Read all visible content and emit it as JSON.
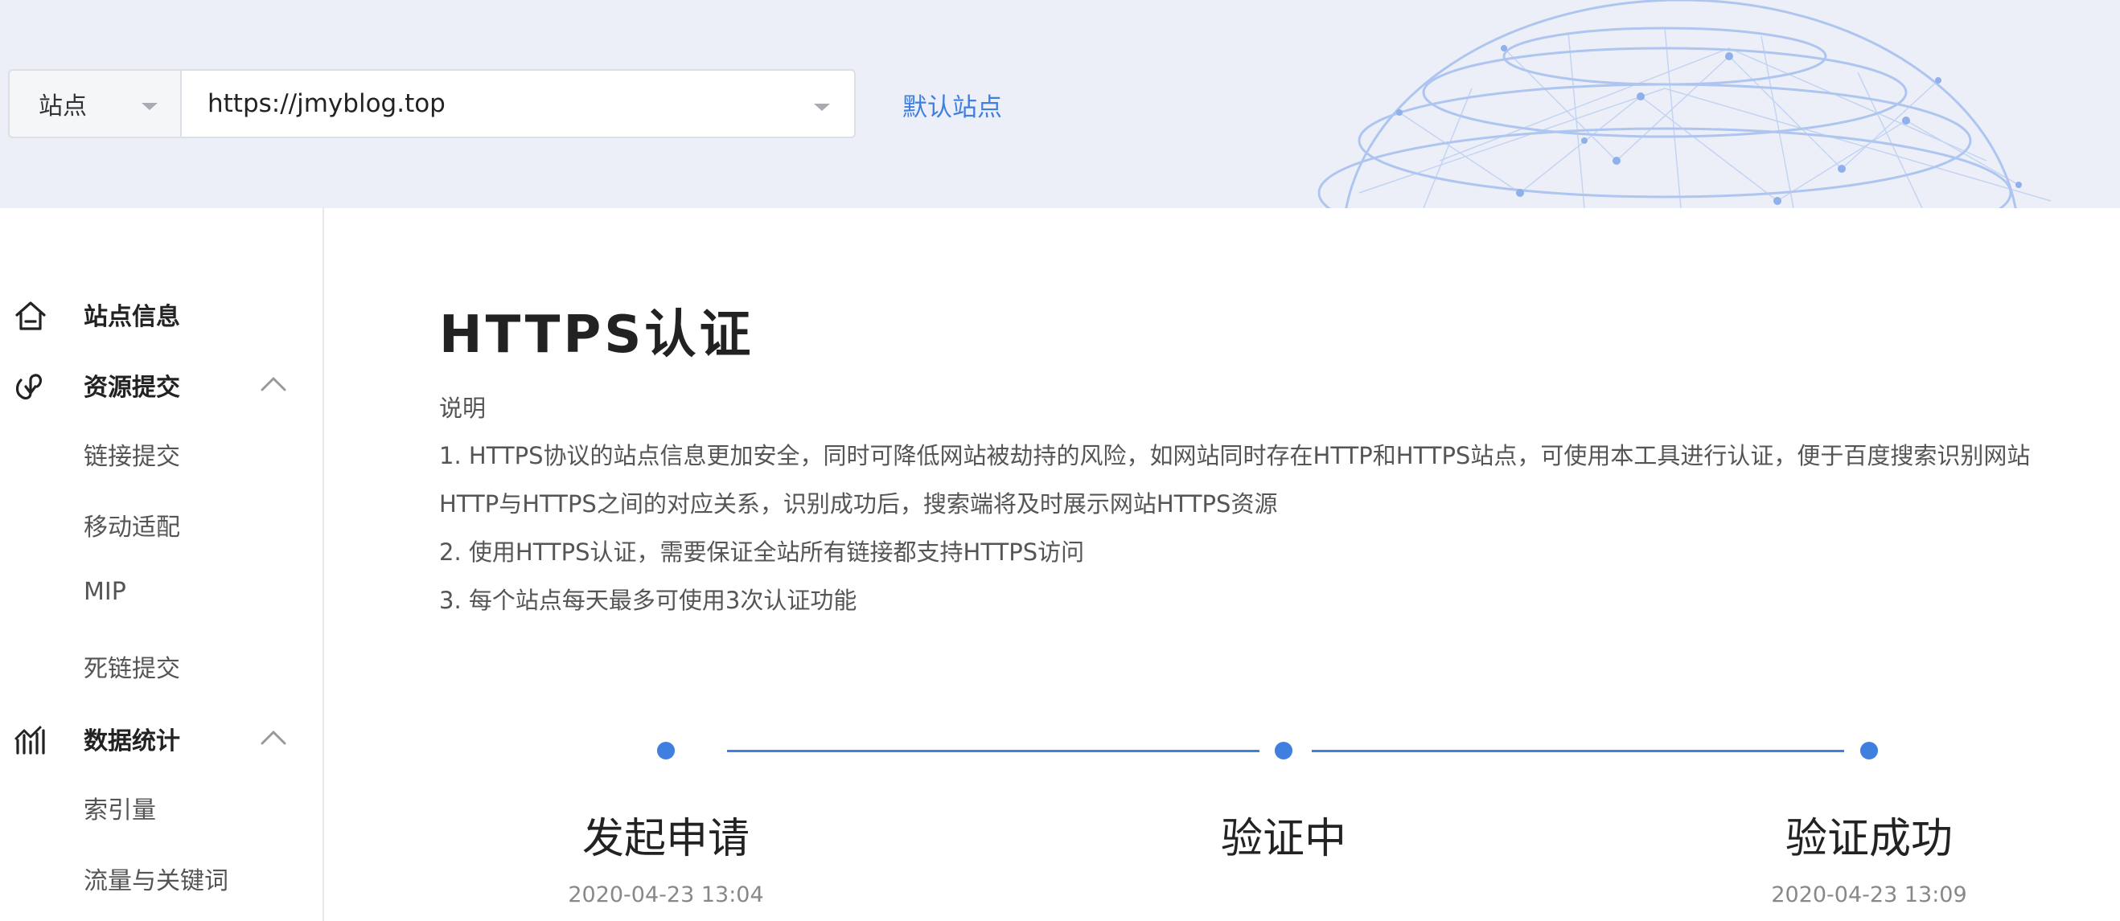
{
  "header": {
    "site_select_label": "站点",
    "url_value": "https://jmyblog.top",
    "default_site_link": "默认站点"
  },
  "sidebar": {
    "site_info": "站点信息",
    "resource_submit": {
      "label": "资源提交",
      "items": [
        "链接提交",
        "移动适配",
        "MIP",
        "死链提交"
      ]
    },
    "data_stats": {
      "label": "数据统计",
      "items": [
        "索引量",
        "流量与关键词"
      ]
    }
  },
  "main": {
    "title": "HTTPS认证",
    "desc_heading": "说明",
    "desc_lines": [
      "1. HTTPS协议的站点信息更加安全，同时可降低网站被劫持的风险，如网站同时存在HTTP和HTTPS站点，可使用本工具进行认证，便于百度搜索识别网站",
      "HTTP与HTTPS之间的对应关系，识别成功后，搜索端将及时展示网站HTTPS资源",
      "2. 使用HTTPS认证，需要保证全站所有链接都支持HTTPS访问",
      "3. 每个站点每天最多可使用3次认证功能"
    ],
    "steps": [
      {
        "label": "发起申请",
        "time": "2020-04-23 13:04"
      },
      {
        "label": "验证中",
        "time": ""
      },
      {
        "label": "验证成功",
        "time": "2020-04-23 13:09"
      }
    ]
  },
  "colors": {
    "accent": "#3f7fe0",
    "banner_bg": "#eceff8"
  }
}
